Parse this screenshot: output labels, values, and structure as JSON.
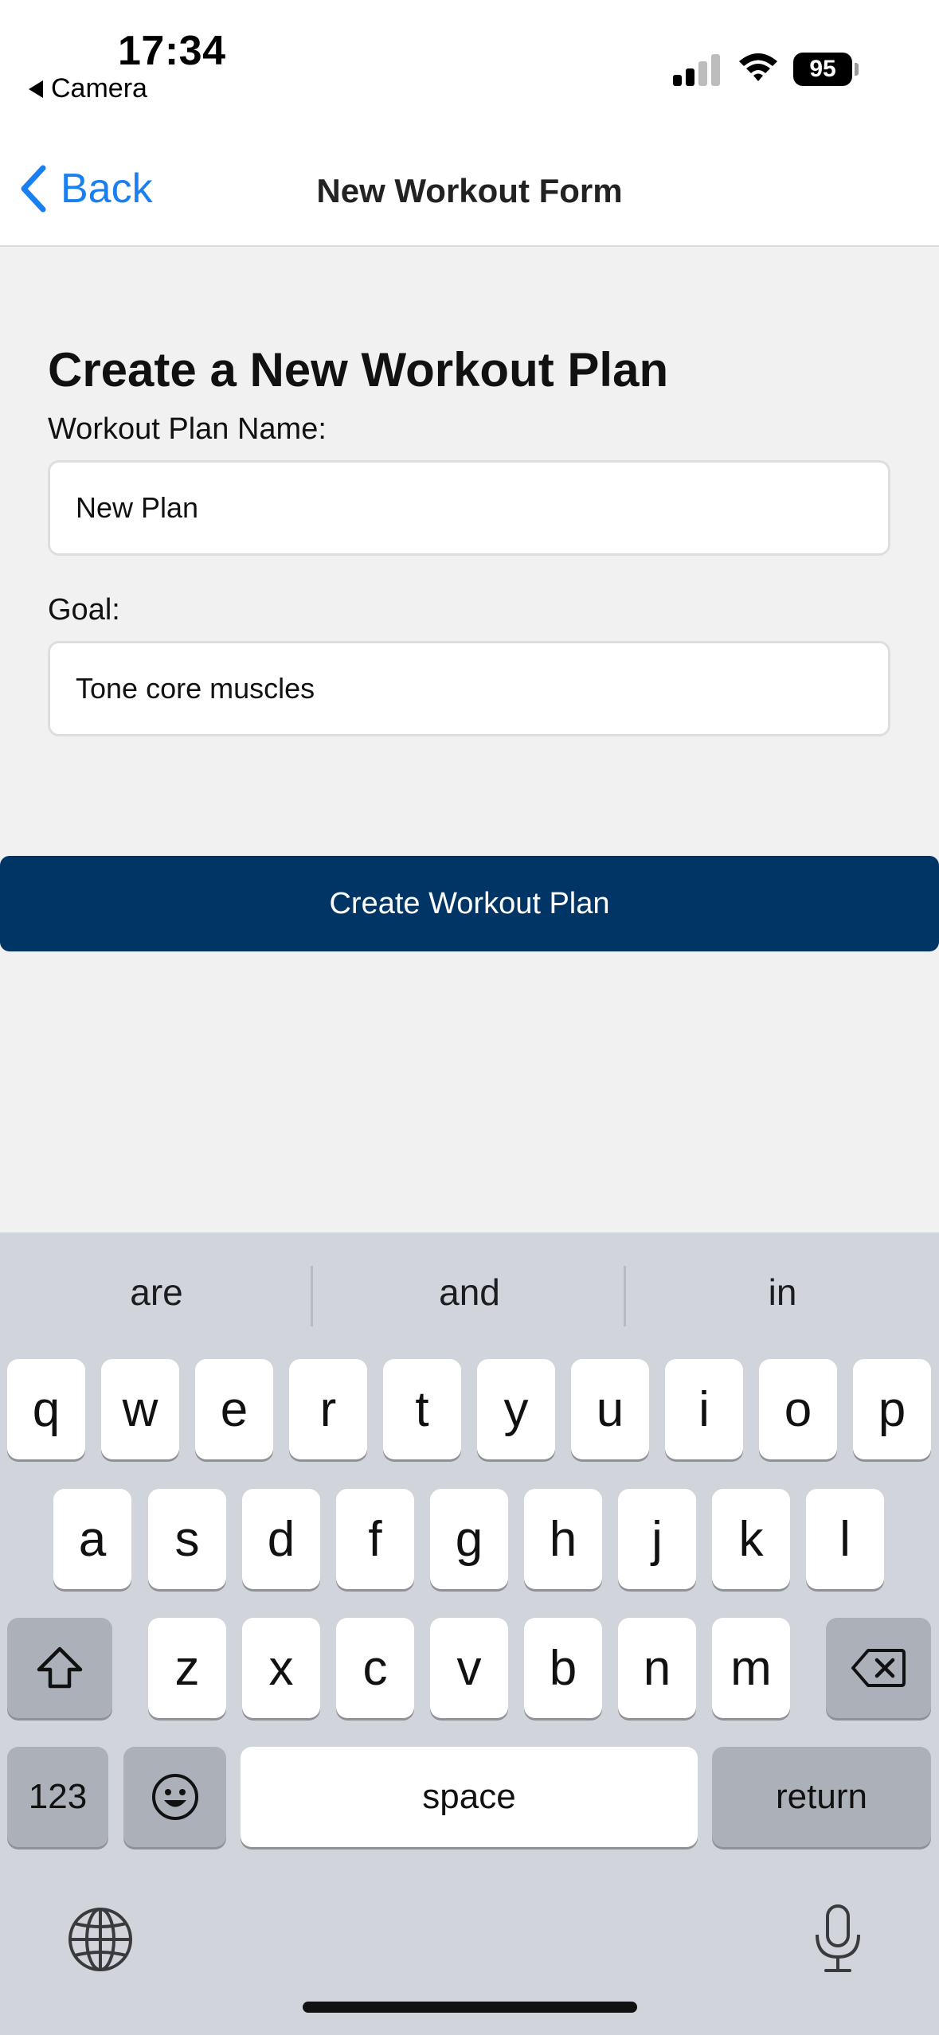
{
  "status_bar": {
    "time": "17:34",
    "back_app": "Camera",
    "battery": "95"
  },
  "nav": {
    "back_label": "Back",
    "title": "New Workout Form"
  },
  "form": {
    "heading": "Create a New Workout Plan",
    "name_label": "Workout Plan Name:",
    "name_value": "New Plan",
    "goal_label": "Goal:",
    "goal_value": "Tone core muscles",
    "submit_label": "Create Workout Plan"
  },
  "colors": {
    "accent": "#1a7ff0",
    "button": "#003566",
    "background": "#f1f1f1",
    "keyboard": "#d1d4db"
  },
  "keyboard": {
    "suggestions": [
      "are",
      "and",
      "in"
    ],
    "row1": [
      "q",
      "w",
      "e",
      "r",
      "t",
      "y",
      "u",
      "i",
      "o",
      "p"
    ],
    "row2": [
      "a",
      "s",
      "d",
      "f",
      "g",
      "h",
      "j",
      "k",
      "l"
    ],
    "row3": [
      "z",
      "x",
      "c",
      "v",
      "b",
      "n",
      "m"
    ],
    "numbers_label": "123",
    "space_label": "space",
    "return_label": "return",
    "icons": [
      "shift-icon",
      "delete-icon",
      "emoji-icon",
      "globe-icon",
      "microphone-icon"
    ]
  }
}
